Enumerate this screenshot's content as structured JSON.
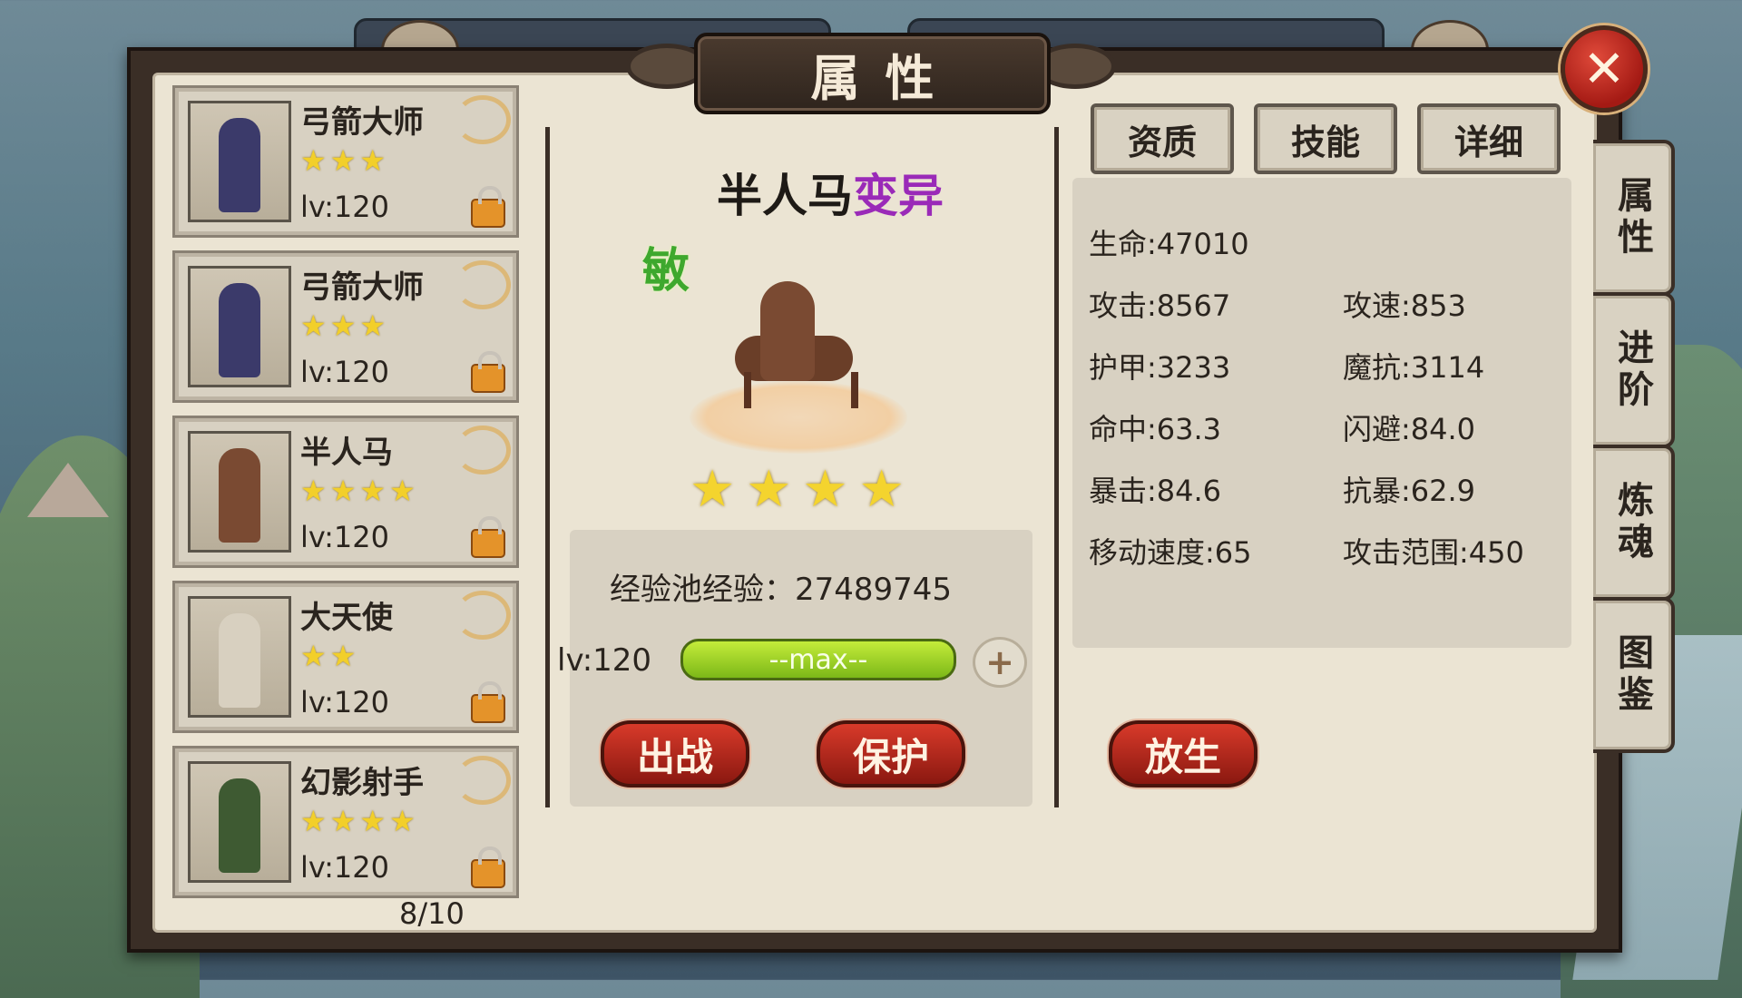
{
  "title": "属性",
  "close_label": "✕",
  "hero_list": [
    {
      "name": "弓箭大师",
      "stars": 3,
      "level": "lv:120",
      "color": "#3b3a6a"
    },
    {
      "name": "弓箭大师",
      "stars": 3,
      "level": "lv:120",
      "color": "#3b3a6a"
    },
    {
      "name": "半人马",
      "stars": 4,
      "level": "lv:120",
      "color": "#7a4a32"
    },
    {
      "name": "大天使",
      "stars": 2,
      "level": "lv:120",
      "color": "#d8d0c0"
    },
    {
      "name": "幻影射手",
      "stars": 4,
      "level": "lv:120",
      "color": "#3e5a32"
    }
  ],
  "list_count": "8/10",
  "hero": {
    "name": "半人马",
    "mutation": "变异",
    "type_badge": "敏",
    "stars": 4
  },
  "exp": {
    "label": "经验池经验：",
    "value": "27489745",
    "level": "lv:120",
    "bar_text": "--max--",
    "plus": "+"
  },
  "actions": {
    "battle": "出战",
    "protect": "保护",
    "release": "放生"
  },
  "tabs": [
    "资质",
    "技能",
    "详细"
  ],
  "stats": {
    "hp": "生命:47010",
    "atk": "攻击:8567",
    "atk_speed": "攻速:853",
    "armor": "护甲:3233",
    "magic_res": "魔抗:3114",
    "hit": "命中:63.3",
    "dodge": "闪避:84.0",
    "crit": "暴击:84.6",
    "crit_res": "抗暴:62.9",
    "move_speed": "移动速度:65",
    "atk_range": "攻击范围:450"
  },
  "side_tabs": [
    "属性",
    "进阶",
    "炼魂",
    "图鉴"
  ]
}
